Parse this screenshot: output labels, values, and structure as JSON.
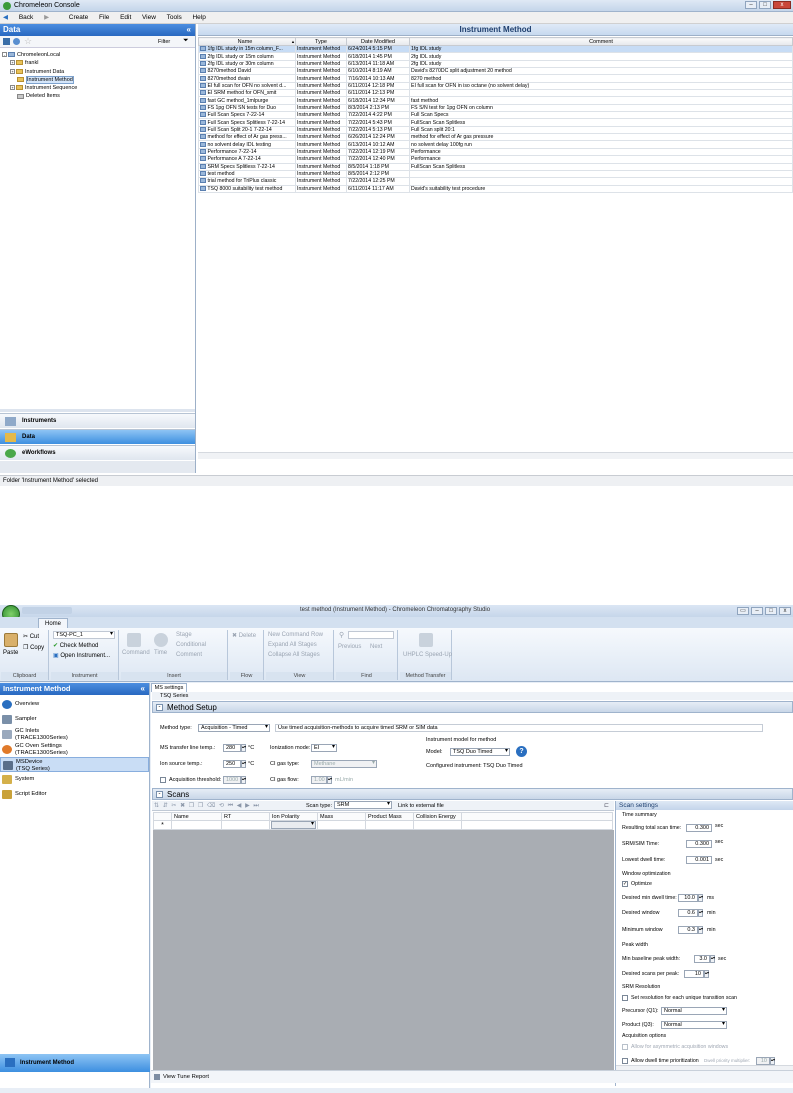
{
  "win1": {
    "title": "Chromeleon Console",
    "menu": [
      "Back",
      "Create",
      "File",
      "Edit",
      "View",
      "Tools",
      "Help"
    ],
    "left_title": "Data",
    "filter_label": "Filter",
    "tree": [
      {
        "label": "ChromeleonLocal",
        "level": 0
      },
      {
        "label": "frankl",
        "level": 1
      },
      {
        "label": "Instrument Data",
        "level": 1
      },
      {
        "label": "Instrument Method",
        "level": 1,
        "selected": true
      },
      {
        "label": "Instrument Sequence",
        "level": 1
      },
      {
        "label": "Deleted Items",
        "level": 1
      }
    ],
    "nav": [
      "Instruments",
      "Data",
      "eWorkflows"
    ],
    "right_title": "Instrument Method",
    "columns": [
      "Name",
      "Type",
      "Date Modified",
      "Comment"
    ],
    "rows": [
      [
        "1fg IDL study in 15m column_F...",
        "Instrument Method",
        "6/24/2014 5:15 PM",
        "1fg IDL study"
      ],
      [
        "2fg IDL study or 15m column",
        "Instrument Method",
        "6/18/2014 1:45 PM",
        "2fg IDL study"
      ],
      [
        "2fg IDL study or 30m column",
        "Instrument Method",
        "6/13/2014 11:18 AM",
        "2fg IDL study"
      ],
      [
        "8270method David",
        "Instrument Method",
        "6/10/2014 8:19 AM",
        "David's 8270DC split adjustment 20 method"
      ],
      [
        "8270method dvain",
        "Instrument Method",
        "7/16/2014 10:13 AM",
        "8270 method"
      ],
      [
        "EI full scan for OFN no solvent d...",
        "Instrument Method",
        "6/11/2014 12:18 PM",
        "EI full scan for OFN in iso octane (no solvent delay)"
      ],
      [
        "EI SRM method for OFN_smit",
        "Instrument Method",
        "6/11/2014 12:13 PM",
        ""
      ],
      [
        "fast GC method_1mlpurge",
        "Instrument Method",
        "6/18/2014 12:34 PM",
        "fast method"
      ],
      [
        "FS 1pg OFN SN tests for Duo",
        "Instrument Method",
        "8/3/2014 2:13 PM",
        "FS S/N test for 1pg OFN on column"
      ],
      [
        "Full Scan Specs 7-22-14",
        "Instrument Method",
        "7/22/2014 4:22 PM",
        "Full Scan Specs"
      ],
      [
        "Full Scan Specs Splitless 7-22-14",
        "Instrument Method",
        "7/22/2014 5:43 PM",
        "FullScan Scan Splitless"
      ],
      [
        "Full Scan Split 20-1 7-22-14",
        "Instrument Method",
        "7/22/2014 5:13 PM",
        "Full Scan split 20:1"
      ],
      [
        "method for effect of Ar gas press...",
        "Instrument Method",
        "6/26/2014 12:24 PM",
        "method for effect of Ar gas pressure"
      ],
      [
        "no solvent delay IDL testing",
        "Instrument Method",
        "6/13/2014 10:12 AM",
        "no solvent delay 100fg run"
      ],
      [
        "Performance 7-22-14",
        "Instrument Method",
        "7/22/2014 12:19 PM",
        "Performance"
      ],
      [
        "Performance A 7-22-14",
        "Instrument Method",
        "7/22/2014 12:40 PM",
        "Performance"
      ],
      [
        "SRM Specs Splitless 7-22-14",
        "Instrument Method",
        "8/5/2014 1:18 PM",
        "FullScan Scan Splitless"
      ],
      [
        "test method",
        "Instrument Method",
        "8/5/2014 2:12 PM",
        ""
      ],
      [
        "trial method for TriPlus classic",
        "Instrument Method",
        "7/22/2014 12:25 PM",
        ""
      ],
      [
        "TSQ 8000 suitability test method",
        "Instrument Method",
        "6/11/2014 11:17 AM",
        "David's suitability test procedure"
      ]
    ],
    "status": "Folder 'Instrument Method' selected"
  },
  "win2": {
    "title": "test method (Instrument Method) - Chromeleon Chromatography Studio",
    "home_tab": "Home",
    "ribbon": {
      "paste": "Paste",
      "cut": "Cut",
      "copy": "Copy",
      "clipboard": "Clipboard",
      "instrument_select": "TSQ-PC_1",
      "check_method": "Check Method",
      "open_instrument": "Open Instrument...",
      "instrument": "Instrument",
      "command": "Command",
      "time": "Time",
      "stage": "Stage",
      "conditional": "Conditional",
      "comment": "Comment",
      "insert": "Insert",
      "delete": "Delete",
      "flow": "Flow",
      "new_command_row": "New Command Row",
      "expand_all": "Expand All Stages",
      "collapse_all": "Collapse All Stages",
      "view": "View",
      "previous": "Previous",
      "next": "Next",
      "find": "Find",
      "uhplc": "UHPLC Speed-Up",
      "method_transfer": "Method Transfer"
    },
    "left_title": "Instrument Method",
    "nav": [
      {
        "label": "Overview"
      },
      {
        "label": "Sampler"
      },
      {
        "label": "GC Inlets",
        "sub": "(TRACE1300Series)"
      },
      {
        "label": "GC Oven Settings",
        "sub": "(TRACE1300Series)"
      },
      {
        "label": "MSDevice",
        "sub": "(TSQ Series)"
      },
      {
        "label": "System"
      },
      {
        "label": "Script Editor"
      }
    ],
    "nav_bottom": "Instrument Method",
    "ms_tab": "MS settings",
    "tsq_series": "TSQ Series",
    "method_setup": {
      "title": "Method Setup",
      "method_type_label": "Method type:",
      "method_type_value": "Acquisition - Timed",
      "method_type_hint": "Use timed acquisition-methods to acquire timed SRM or SIM data",
      "ms_transfer_label": "MS transfer line temp.:",
      "ms_transfer_value": "280",
      "unit_c": "°C",
      "ion_source_label": "Ion source temp.:",
      "ion_source_value": "250",
      "acq_threshold_label": "Acquisition threshold:",
      "acq_threshold_value": "1000",
      "ionization_label": "Ionization mode:",
      "ionization_value": "EI",
      "ci_gas_type_label": "CI gas type:",
      "ci_gas_type_value": "Methane",
      "ci_gas_flow_label": "CI gas flow:",
      "ci_gas_flow_value": "1.00",
      "ci_gas_flow_unit": "mL/min",
      "model_section": "Instrument model for method",
      "model_label": "Model:",
      "model_value": "TSQ Duo Timed",
      "configured": "Configured instrument: TSQ Duo Timed"
    },
    "scans": {
      "title": "Scans",
      "scan_type_label": "Scan type:",
      "scan_type_value": "SRM",
      "link_external": "Link to external file",
      "columns": [
        "Name",
        "RT",
        "Ion Polarity",
        "Mass",
        "Product Mass",
        "Collision Energy"
      ],
      "new_row_marker": "*"
    },
    "scan_settings": {
      "title": "Scan settings",
      "time_summary": "Time summary",
      "total_scan_time_label": "Resulting total scan time:",
      "total_scan_time_value": "0.300",
      "sec": "sec",
      "srm_time_label": "SRM/SIM Time:",
      "srm_time_value": "0.300",
      "lowest_dwell_label": "Lowest dwell time:",
      "lowest_dwell_value": "0.001",
      "window_opt": "Window optimization",
      "optimize": "Optimize",
      "min_dwell_label": "Desired min dwell time:",
      "min_dwell_value": "10.0",
      "ms": "ms",
      "desired_window_label": "Desired window",
      "desired_window_value": "0.6",
      "min": "min",
      "minimum_window_label": "Minimum window",
      "minimum_window_value": "0.3",
      "peak_width": "Peak width",
      "min_baseline_label": "Min baseline peak width:",
      "min_baseline_value": "3.0",
      "desired_scans_label": "Desired scans per peak:",
      "desired_scans_value": "10",
      "srm_resolution": "SRM Resolution",
      "set_resolution": "Set resolution for each unique transition scan",
      "precursor_label": "Precursor (Q1):",
      "precursor_value": "Normal",
      "product_label": "Product (Q3):",
      "product_value": "Normal",
      "acq_options": "Acquisition options",
      "allow_asym": "Allow for asymmetric acquisition windows",
      "allow_dwell": "Allow dwell time prioritization",
      "priority_label": "Dwell priority multiplier:",
      "priority_value": "10"
    },
    "view_tune": "View Tune Report"
  }
}
